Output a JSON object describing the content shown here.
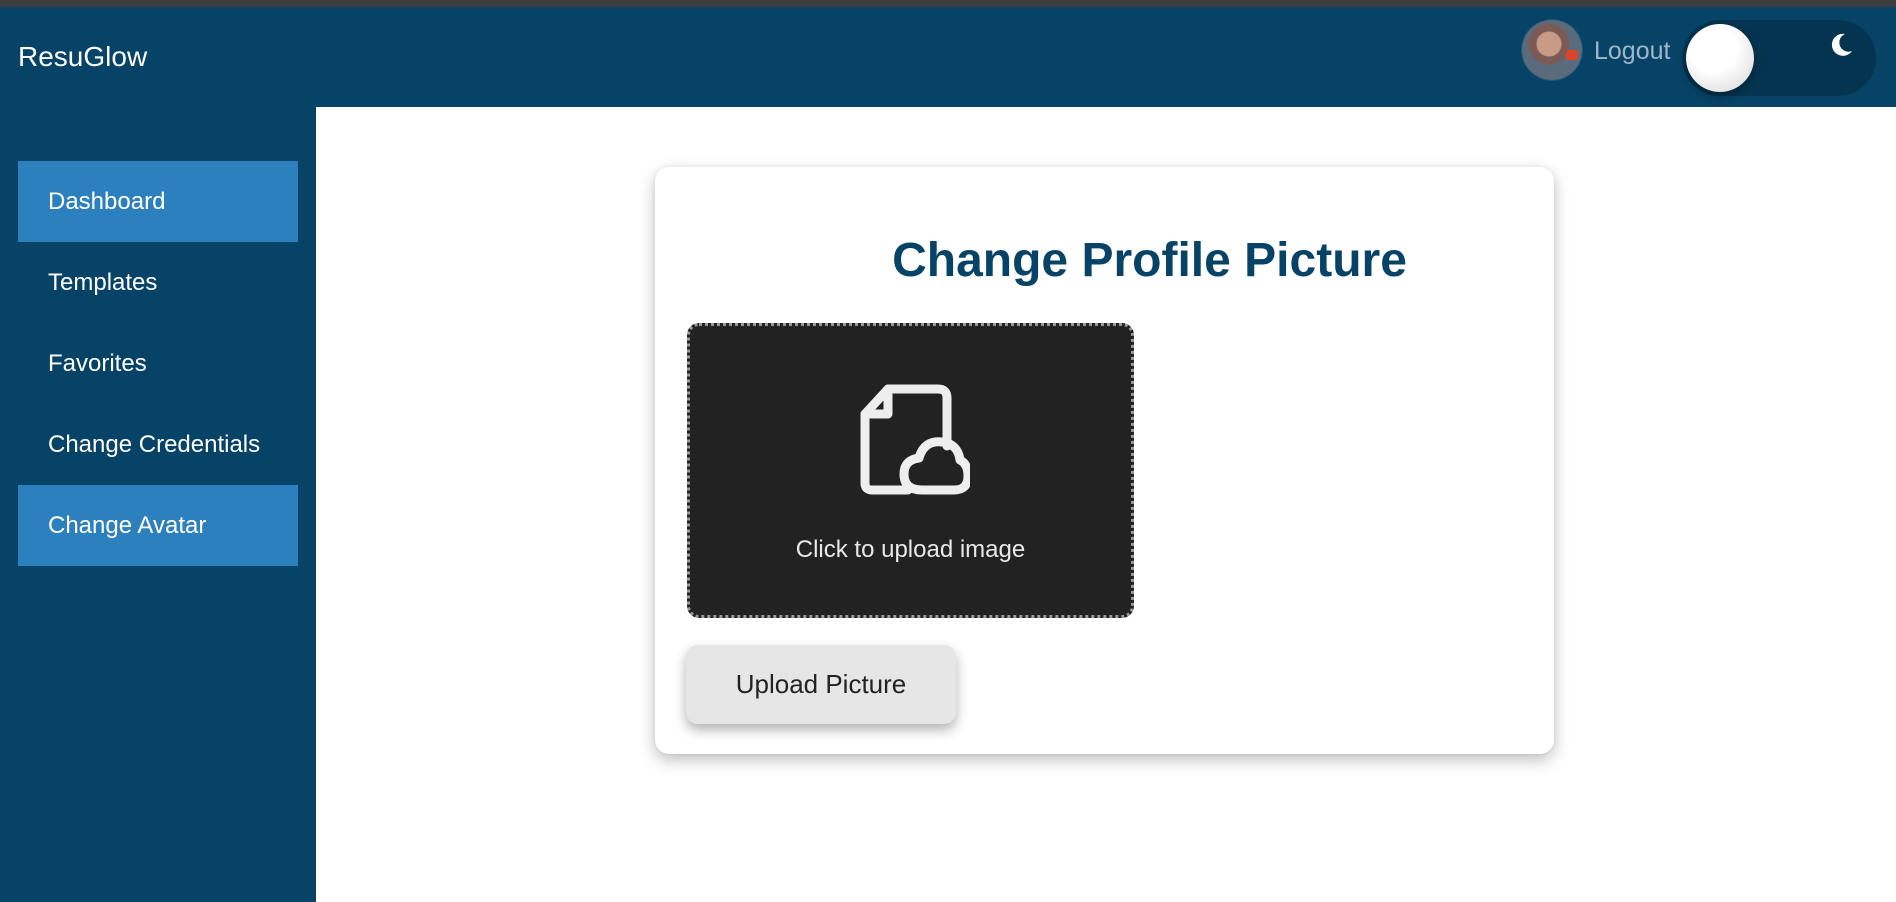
{
  "app": {
    "brand": "ResuGlow"
  },
  "header": {
    "logout_label": "Logout",
    "theme_toggle_icon": "moon-icon",
    "avatar_icon": "user-avatar"
  },
  "sidebar": {
    "items": [
      {
        "label": "Dashboard",
        "active": true
      },
      {
        "label": "Templates",
        "active": false
      },
      {
        "label": "Favorites",
        "active": false
      },
      {
        "label": "Change Credentials",
        "active": false
      },
      {
        "label": "Change Avatar",
        "active": true
      }
    ]
  },
  "main": {
    "title": "Change Profile Picture",
    "dropzone_label": "Click to upload image",
    "dropzone_icon": "file-cloud-upload-icon",
    "upload_button": "Upload Picture"
  },
  "colors": {
    "primary": "#064366",
    "active_nav": "#2b80bd",
    "dropzone_bg": "#222222"
  }
}
